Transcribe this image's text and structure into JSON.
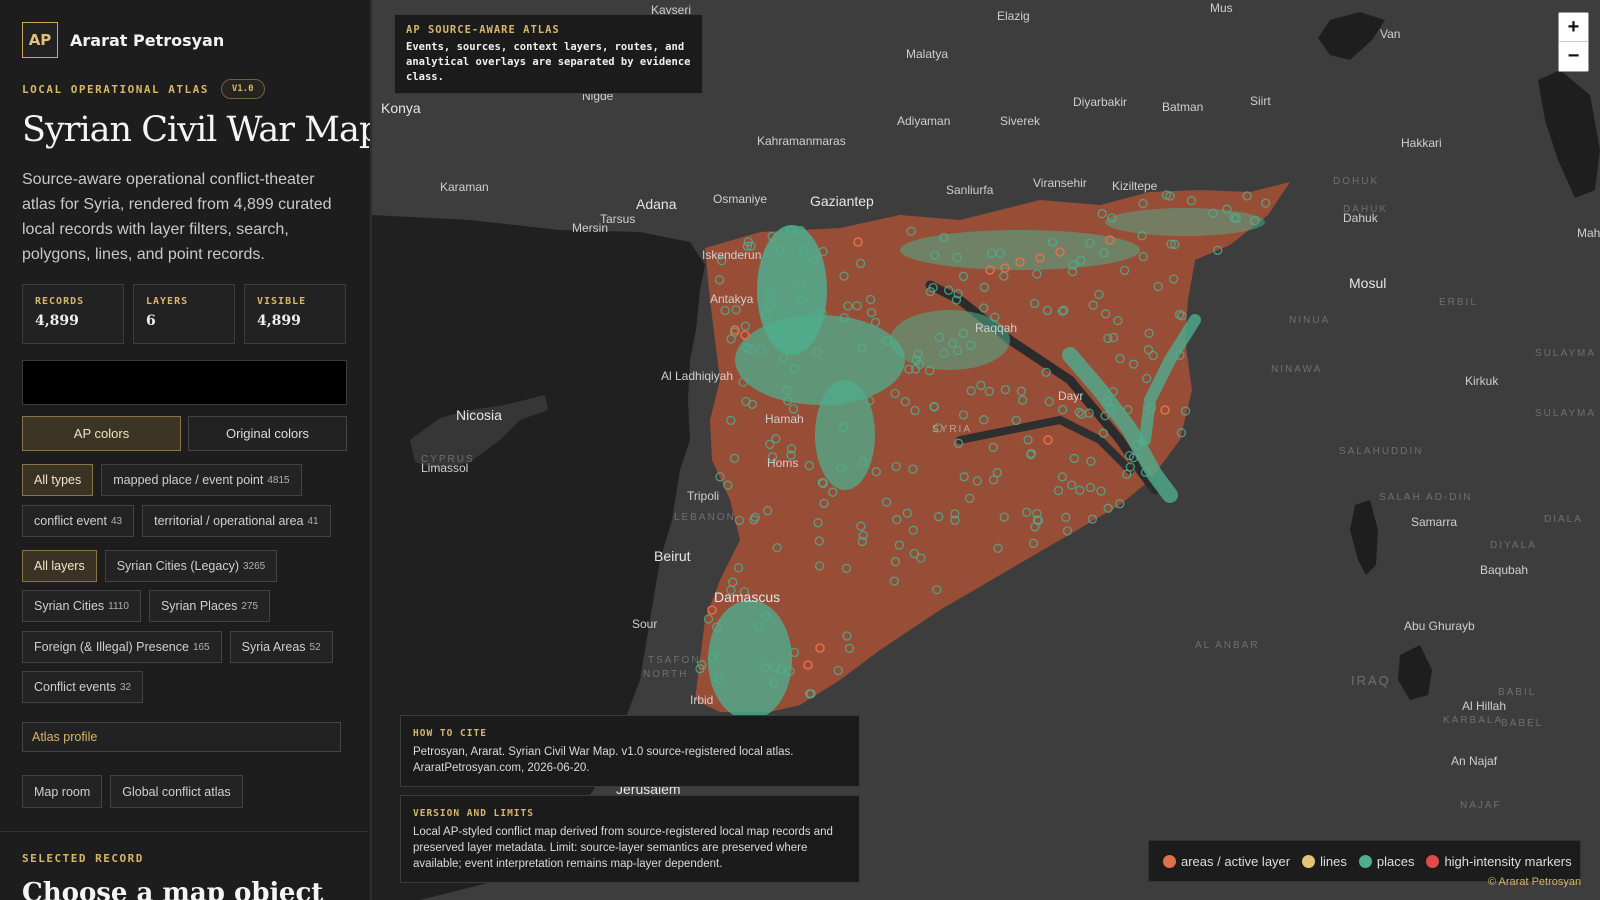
{
  "brand": {
    "logo": "AP",
    "name": "Ararat Petrosyan"
  },
  "atlas": {
    "kicker": "LOCAL OPERATIONAL ATLAS",
    "version": "V1.0",
    "title": "Syrian Civil War Map",
    "description": "Source-aware operational conflict-theater atlas for Syria, rendered from 4,899 curated local records with layer filters, search, polygons, lines, and point records."
  },
  "stats": [
    {
      "label": "RECORDS",
      "value": "4,899"
    },
    {
      "label": "LAYERS",
      "value": "6"
    },
    {
      "label": "VISIBLE",
      "value": "4,899"
    }
  ],
  "search": {
    "placeholder": "",
    "value": ""
  },
  "color_modes": {
    "ap": "AP colors",
    "original": "Original colors",
    "selected": "AP colors"
  },
  "type_filters": [
    {
      "label": "All types",
      "count": "",
      "active": true
    },
    {
      "label": "mapped place / event point",
      "count": "4815",
      "active": false
    },
    {
      "label": "conflict event",
      "count": "43",
      "active": false
    },
    {
      "label": "territorial / operational area",
      "count": "41",
      "active": false
    }
  ],
  "layer_filters": [
    {
      "label": "All layers",
      "count": "",
      "active": true
    },
    {
      "label": "Syrian Cities (Legacy)",
      "count": "3265",
      "active": false
    },
    {
      "label": "Syrian Cities",
      "count": "1110",
      "active": false
    },
    {
      "label": "Syrian Places",
      "count": "275",
      "active": false
    },
    {
      "label": "Foreign (& Illegal) Presence",
      "count": "165",
      "active": false
    },
    {
      "label": "Syria Areas",
      "count": "52",
      "active": false
    },
    {
      "label": "Conflict events",
      "count": "32",
      "active": false
    }
  ],
  "profile_link": "Atlas profile",
  "nav_links": {
    "map_room": "Map room",
    "global_atlas": "Global conflict atlas"
  },
  "selected": {
    "kicker": "SELECTED RECORD",
    "title": "Choose a map object"
  },
  "intro": {
    "kicker": "AP SOURCE-AWARE ATLAS",
    "text": "Events, sources, context layers, routes, and analytical overlays are separated by evidence class."
  },
  "cite": {
    "kicker": "HOW TO CITE",
    "text": "Petrosyan, Ararat. Syrian Civil War Map. v1.0 source-registered local atlas. AraratPetrosyan.com, 2026-06-20."
  },
  "limits": {
    "kicker": "VERSION AND LIMITS",
    "text": "Local AP-styled conflict map derived from source-registered local map records and preserved layer metadata. Limit: source-layer semantics are preserved where available; event interpretation remains map-layer dependent."
  },
  "zoom": {
    "in": "+",
    "out": "−"
  },
  "legend": [
    {
      "label": "areas / active layer",
      "color": "#e0704a"
    },
    {
      "label": "lines",
      "color": "#e5c47a"
    },
    {
      "label": "places",
      "color": "#4fae8e"
    },
    {
      "label": "high-intensity markers",
      "color": "#e04a4a"
    }
  ],
  "credit": "© Ararat Petrosyan",
  "map_places": [
    "Kayseri",
    "Elazig",
    "Mus",
    "Van",
    "Malatya",
    "Konya",
    "Nigde",
    "Diyarbakir",
    "Batman",
    "Siirt",
    "Adiyaman",
    "Siverek",
    "Kahramanmaras",
    "Hakkari",
    "Karaman",
    "Adana",
    "Osmaniye",
    "Gaziantep",
    "Sanliurfa",
    "Viransehir",
    "Kiziltepe",
    "Dahuk",
    "Mersin",
    "Tarsus",
    "Iskenderun",
    "Mosul",
    "Antakya",
    "Al Ladhiqiyah",
    "Nicosia",
    "Hamah",
    "Homs",
    "Limassol",
    "Tripoli",
    "Beirut",
    "Damascus",
    "Sour",
    "Irbid",
    "Jerusalem",
    "Kirkuk",
    "Samarra",
    "Baqubah",
    "Abu Ghurayb",
    "Al Hillah",
    "An Najaf",
    "Mah",
    "Dayr",
    "Raqqah"
  ],
  "map_regions": [
    "DOHUK",
    "DAHUK",
    "ERBIL",
    "NINUA",
    "NINAWA",
    "SULAYMA",
    "SULAYMA",
    "SALAHUDDIN",
    "SALAH AD-DIN",
    "DIYALA",
    "DIALA",
    "AL ANBAR",
    "BABIL",
    "BABEL",
    "KARBALA",
    "NAJAF",
    "TSAFON",
    "NORTH",
    "IRAQ",
    "CYPRUS",
    "LEBANON",
    "SYRIA"
  ]
}
